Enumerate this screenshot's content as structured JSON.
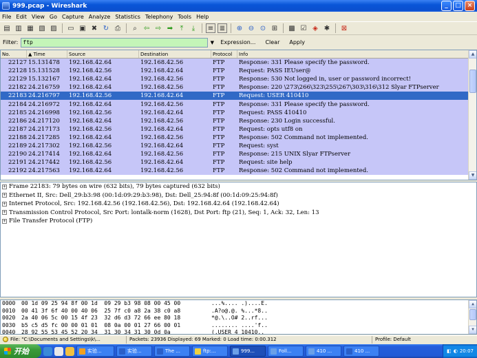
{
  "window": {
    "title": "999.pcap - Wireshark"
  },
  "menu": [
    "File",
    "Edit",
    "View",
    "Go",
    "Capture",
    "Analyze",
    "Statistics",
    "Telephony",
    "Tools",
    "Help"
  ],
  "filter": {
    "label": "Filter:",
    "value": "ftp",
    "expression_label": "Expression...",
    "clear_label": "Clear",
    "apply_label": "Apply"
  },
  "packet_list": {
    "columns": [
      "No.",
      "Time",
      "Source",
      "Destination",
      "Protocol",
      "Info"
    ],
    "selected_no": "22183",
    "rows": [
      {
        "no": "22127",
        "time": "15.131478",
        "src": "192.168.42.64",
        "dst": "192.168.42.56",
        "proto": "FTP",
        "info": "Response: 331 Please specify the password."
      },
      {
        "no": "22128",
        "time": "15.131528",
        "src": "192.168.42.56",
        "dst": "192.168.42.64",
        "proto": "FTP",
        "info": "Request: PASS IEUser@"
      },
      {
        "no": "22129",
        "time": "15.132167",
        "src": "192.168.42.64",
        "dst": "192.168.42.56",
        "proto": "FTP",
        "info": "Response: 530 Not logged in, user or password incorrect!"
      },
      {
        "no": "22182",
        "time": "24.216759",
        "src": "192.168.42.64",
        "dst": "192.168.42.56",
        "proto": "FTP",
        "info": "Response: 220 \\273\\266\\323\\255\\267\\303\\316\\312 Slyar FTPserver"
      },
      {
        "no": "22183",
        "time": "24.216797",
        "src": "192.168.42.56",
        "dst": "192.168.42.64",
        "proto": "FTP",
        "info": "Request: USER 410410"
      },
      {
        "no": "22184",
        "time": "24.216972",
        "src": "192.168.42.64",
        "dst": "192.168.42.56",
        "proto": "FTP",
        "info": "Response: 331 Please specify the password."
      },
      {
        "no": "22185",
        "time": "24.216998",
        "src": "192.168.42.56",
        "dst": "192.168.42.64",
        "proto": "FTP",
        "info": "Request: PASS 410410"
      },
      {
        "no": "22186",
        "time": "24.217120",
        "src": "192.168.42.64",
        "dst": "192.168.42.56",
        "proto": "FTP",
        "info": "Response: 230 Login successful."
      },
      {
        "no": "22187",
        "time": "24.217173",
        "src": "192.168.42.56",
        "dst": "192.168.42.64",
        "proto": "FTP",
        "info": "Request: opts utf8 on"
      },
      {
        "no": "22188",
        "time": "24.217285",
        "src": "192.168.42.64",
        "dst": "192.168.42.56",
        "proto": "FTP",
        "info": "Response: 502 Command not implemented."
      },
      {
        "no": "22189",
        "time": "24.217302",
        "src": "192.168.42.56",
        "dst": "192.168.42.64",
        "proto": "FTP",
        "info": "Request: syst"
      },
      {
        "no": "22190",
        "time": "24.217414",
        "src": "192.168.42.64",
        "dst": "192.168.42.56",
        "proto": "FTP",
        "info": "Response: 215 UNIX Slyar FTPserver"
      },
      {
        "no": "22191",
        "time": "24.217442",
        "src": "192.168.42.56",
        "dst": "192.168.42.64",
        "proto": "FTP",
        "info": "Request: site help"
      },
      {
        "no": "22192",
        "time": "24.217563",
        "src": "192.168.42.64",
        "dst": "192.168.42.56",
        "proto": "FTP",
        "info": "Response: 502 Command not implemented."
      }
    ]
  },
  "details": [
    "Frame 22183: 79 bytes on wire (632 bits), 79 bytes captured (632 bits)",
    "Ethernet II, Src: Dell_29:b3:98 (00:1d:09:29:b3:98), Dst: Dell_25:94:8f (00:1d:09:25:94:8f)",
    "Internet Protocol, Src: 192.168.42.56 (192.168.42.56), Dst: 192.168.42.64 (192.168.42.64)",
    "Transmission Control Protocol, Src Port: lontalk-norm (1628), Dst Port: ftp (21), Seq: 1, Ack: 32, Len: 13",
    "File Transfer Protocol (FTP)"
  ],
  "hex": [
    {
      "off": "0000",
      "bytes": "00 1d 09 25 94 8f 00 1d  09 29 b3 98 08 00 45 00",
      "ascii": "...%.... .)....E."
    },
    {
      "off": "0010",
      "bytes": "00 41 3f 6f 40 00 40 06  25 7f c0 a8 2a 38 c0 a8",
      "ascii": ".A?o@.@. %...*8.."
    },
    {
      "off": "0020",
      "bytes": "2a 40 06 5c 00 15 4f 23  32 d6 d3 72 66 ee 80 18",
      "ascii": "*@.\\..O# 2..rf..."
    },
    {
      "off": "0030",
      "bytes": "b5 c5 d5 fc 00 00 01 01  08 0a 00 01 27 66 00 01",
      "ascii": "........ ....'f.."
    },
    {
      "off": "0040",
      "bytes": "28 92 55 53 45 52 20 34  31 30 34 31 30 0d 0a",
      "ascii": "(.USER 4 10410.."
    }
  ],
  "status": {
    "file": "File: \"C:\\Documents and Settings\\k\\...",
    "packets": "Packets: 23936 Displayed: 69 Marked: 0 Load time: 0:00.312",
    "profile": "Profile: Default"
  },
  "taskbar": {
    "start_label": "开始",
    "tasks": [
      "实验...",
      "实验...",
      "The ...",
      "ftp:...",
      "999...",
      "Foll...",
      "410 ...",
      "410 ..."
    ],
    "clock": "20:07"
  },
  "colors": {
    "row_bg": "#c6c6f8",
    "selected_bg": "#3169c6",
    "filter_bg": "#c4f5b8"
  }
}
